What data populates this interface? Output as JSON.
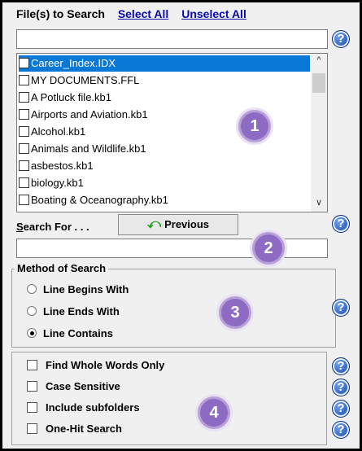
{
  "header": {
    "files_label": "File(s) to Search",
    "select_all": "Select All",
    "unselect_all": "Unselect All"
  },
  "file_filter": {
    "value": ""
  },
  "file_list": {
    "items": [
      {
        "label": "Career_Index.IDX",
        "checked": false,
        "selected": true
      },
      {
        "label": "MY DOCUMENTS.FFL",
        "checked": false,
        "selected": false
      },
      {
        "label": "A Potluck file.kb1",
        "checked": false,
        "selected": false
      },
      {
        "label": "Airports and Aviation.kb1",
        "checked": false,
        "selected": false
      },
      {
        "label": "Alcohol.kb1",
        "checked": false,
        "selected": false
      },
      {
        "label": "Animals and Wildlife.kb1",
        "checked": false,
        "selected": false
      },
      {
        "label": "asbestos.kb1",
        "checked": false,
        "selected": false
      },
      {
        "label": "biology.kb1",
        "checked": false,
        "selected": false
      },
      {
        "label": "Boating & Oceanography.kb1",
        "checked": false,
        "selected": false
      }
    ]
  },
  "search": {
    "label": "Search For . . .",
    "previous_button": "Previous",
    "value": ""
  },
  "method": {
    "title": "Method of Search",
    "options": [
      {
        "label": "Line Begins With",
        "selected": false
      },
      {
        "label": "Line Ends With",
        "selected": false
      },
      {
        "label": "Line Contains",
        "selected": true
      }
    ]
  },
  "options": {
    "items": [
      {
        "label": "Find Whole Words Only",
        "checked": false
      },
      {
        "label": "Case Sensitive",
        "checked": false
      },
      {
        "label": "Include subfolders",
        "checked": false
      },
      {
        "label": "One-Hit Search",
        "checked": false
      }
    ]
  },
  "badges": [
    "1",
    "2",
    "3",
    "4"
  ],
  "help_glyph": "?",
  "icons": {
    "help": "help-question-icon",
    "previous": "green-return-arrow-icon",
    "scroll_up": "chevron-up-icon",
    "scroll_down": "chevron-down-icon"
  },
  "colors": {
    "selection": "#0a78d7",
    "link": "#0a0aa8",
    "badge": "#8e6bc3",
    "help": "#1f5fd1"
  }
}
